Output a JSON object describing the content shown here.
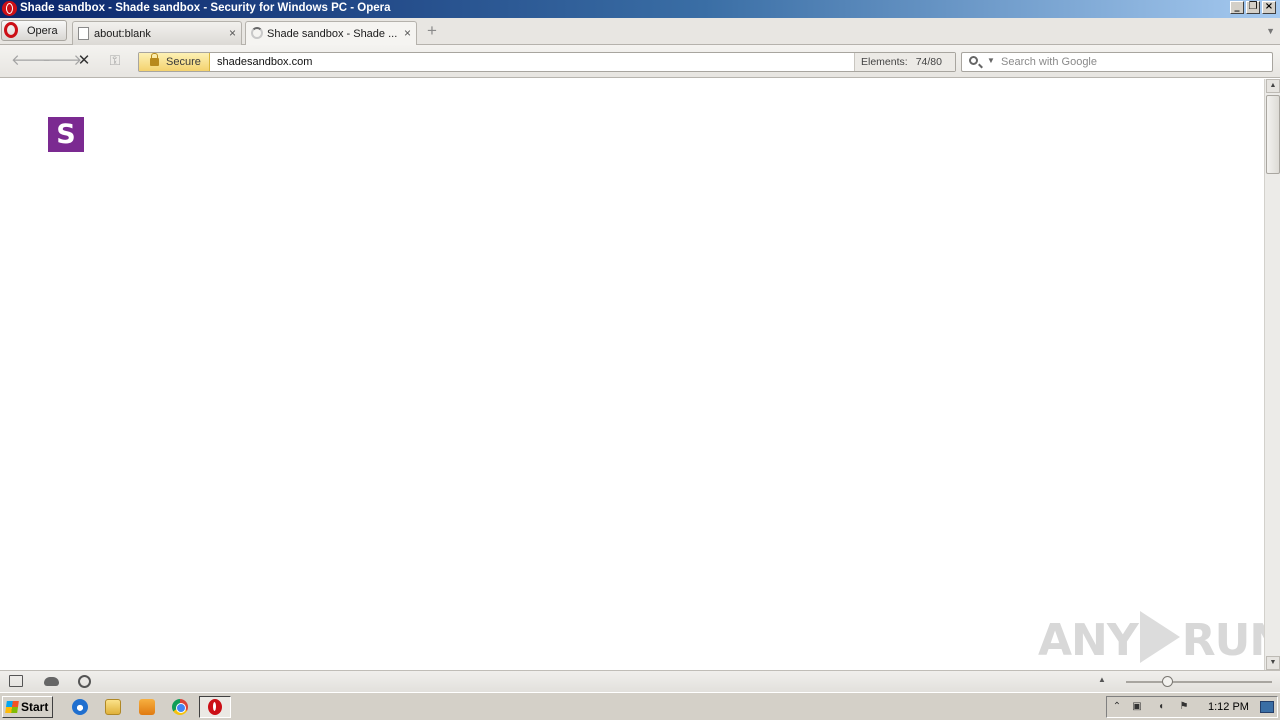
{
  "window": {
    "title": "Shade sandbox - Shade sandbox - Security for Windows PC - Opera",
    "controls": [
      "minimize",
      "restore",
      "close"
    ]
  },
  "tabbar": {
    "menu_label": "Opera",
    "tabs": [
      {
        "label": "about:blank",
        "active": false,
        "icon": "page-icon"
      },
      {
        "label": "Shade sandbox - Shade ...",
        "active": true,
        "icon": "loading-spinner-icon"
      }
    ]
  },
  "navbar": {
    "security_label": "Secure",
    "url": "shadesandbox.com",
    "elements_label": "Elements:",
    "elements_value": "74/80",
    "search_placeholder": "Search with Google"
  },
  "page": {
    "logo_letter": "S",
    "logo_color": "#7b2a91"
  },
  "watermark": {
    "left": "ANY",
    "right": "RUN"
  },
  "taskbar": {
    "start_label": "Start",
    "clock": "1:12 PM",
    "quick_launch": [
      "internet-explorer-icon",
      "folder-icon",
      "media-player-icon",
      "chrome-icon"
    ],
    "running": [
      "opera-icon"
    ]
  },
  "colors": {
    "titlebar": "#0a246a",
    "secure_badge": "#f4d26e",
    "opera_red": "#cc0f16"
  }
}
